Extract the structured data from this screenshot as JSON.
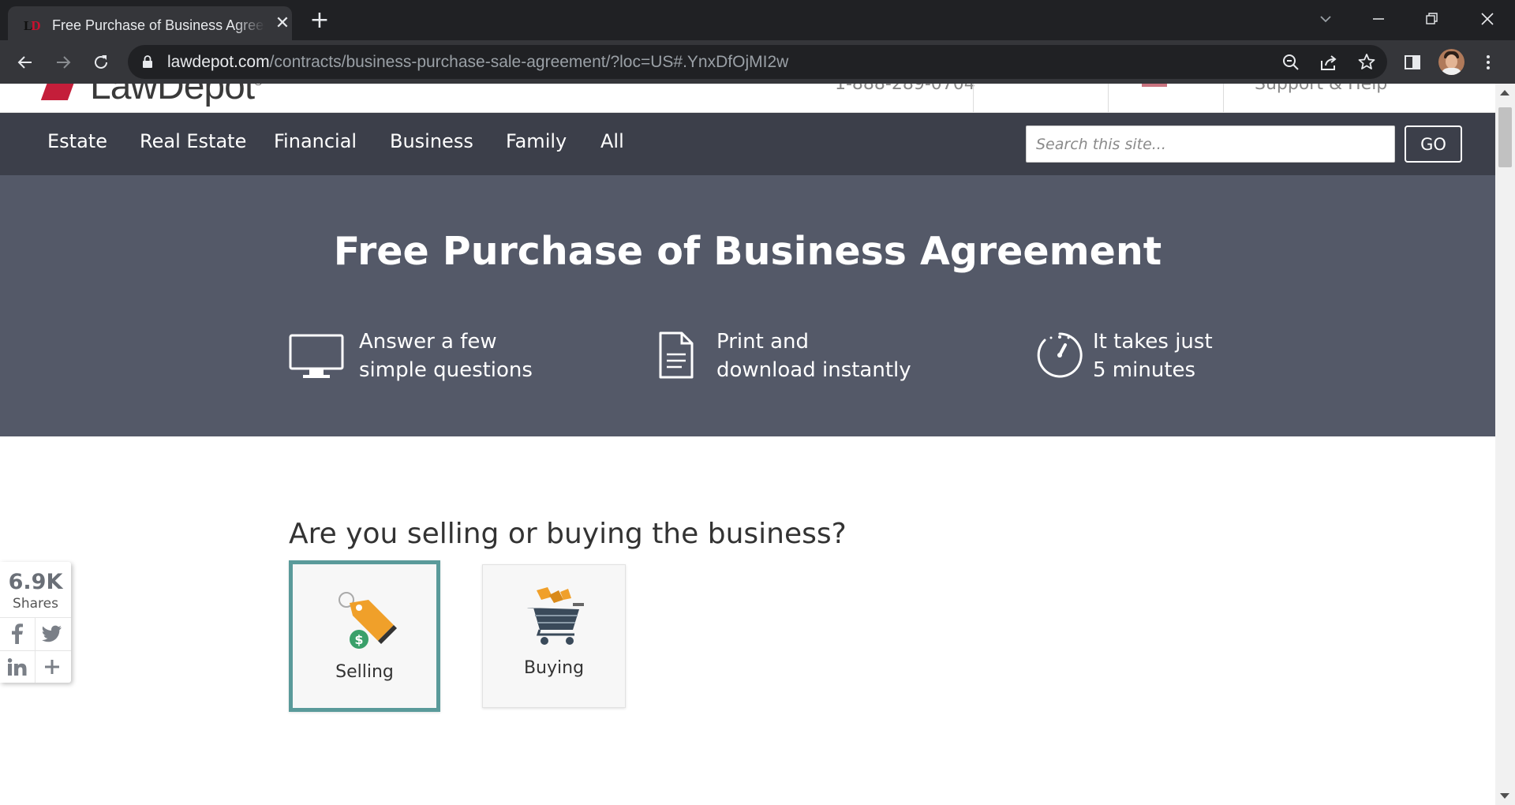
{
  "browser": {
    "tab_title": "Free Purchase of Business Agreement",
    "tab_close": "✕",
    "new_tab": "+",
    "url_host": "lawdepot.com",
    "url_path": "/contracts/business-purchase-sale-agreement/?loc=US#.YnxDfOjMI2w"
  },
  "site": {
    "nav": [
      "Estate",
      "Real Estate",
      "Financial",
      "Business",
      "Family",
      "All"
    ],
    "search_placeholder": "Search this site...",
    "go_label": "GO"
  },
  "hero": {
    "title": "Free Purchase of Business Agreement",
    "features": [
      {
        "line1": "Answer a few",
        "line2": "simple questions",
        "icon": "monitor-icon"
      },
      {
        "line1": "Print and",
        "line2": "download instantly",
        "icon": "document-icon"
      },
      {
        "line1": "It takes just",
        "line2": "5 minutes",
        "icon": "timer-icon"
      }
    ]
  },
  "question": {
    "text": "Are you selling or buying the business?",
    "options": [
      {
        "label": "Selling",
        "selected": true,
        "icon": "price-tag-icon"
      },
      {
        "label": "Buying",
        "selected": false,
        "icon": "shopping-cart-icon"
      }
    ]
  },
  "share": {
    "count": "6.9K",
    "label": "Shares",
    "buttons": [
      "facebook-icon",
      "twitter-icon",
      "linkedin-icon",
      "plus-icon"
    ]
  },
  "colors": {
    "nav_bg": "#3c3f4a",
    "hero_bg": "#545968",
    "selected_border": "#5a9a9a"
  }
}
